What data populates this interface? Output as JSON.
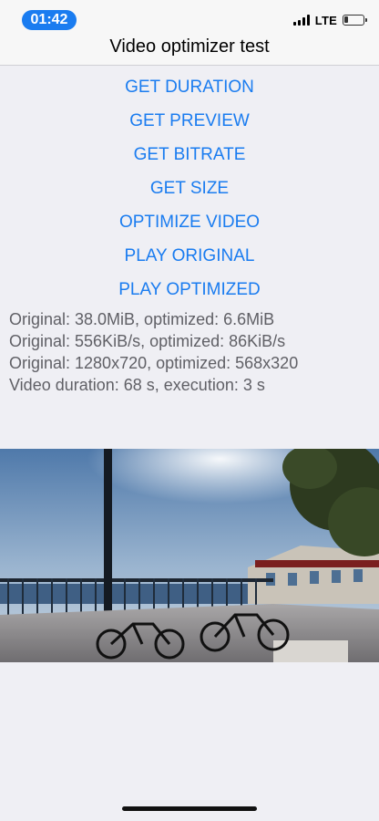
{
  "status_bar": {
    "time": "01:42",
    "network": "LTE"
  },
  "nav": {
    "title": "Video optimizer test"
  },
  "buttons": [
    {
      "label": "GET DURATION"
    },
    {
      "label": "GET PREVIEW"
    },
    {
      "label": "GET BITRATE"
    },
    {
      "label": "GET SIZE"
    },
    {
      "label": "OPTIMIZE VIDEO"
    },
    {
      "label": "PLAY ORIGINAL"
    },
    {
      "label": "PLAY OPTIMIZED"
    }
  ],
  "info": {
    "size_line": "Original: 38.0MiB, optimized: 6.6MiB",
    "bitrate_line": "Original: 556KiB/s, optimized: 86KiB/s",
    "resolution_line": "Original: 1280x720, optimized: 568x320",
    "duration_line": "Video duration: 68 s, execution: 3 s"
  },
  "colors": {
    "accent": "#1a7cf0",
    "background": "#efeff4",
    "info_text": "#606066"
  },
  "icons": {
    "signal": "cellular-signal-icon",
    "battery": "battery-low-icon"
  }
}
